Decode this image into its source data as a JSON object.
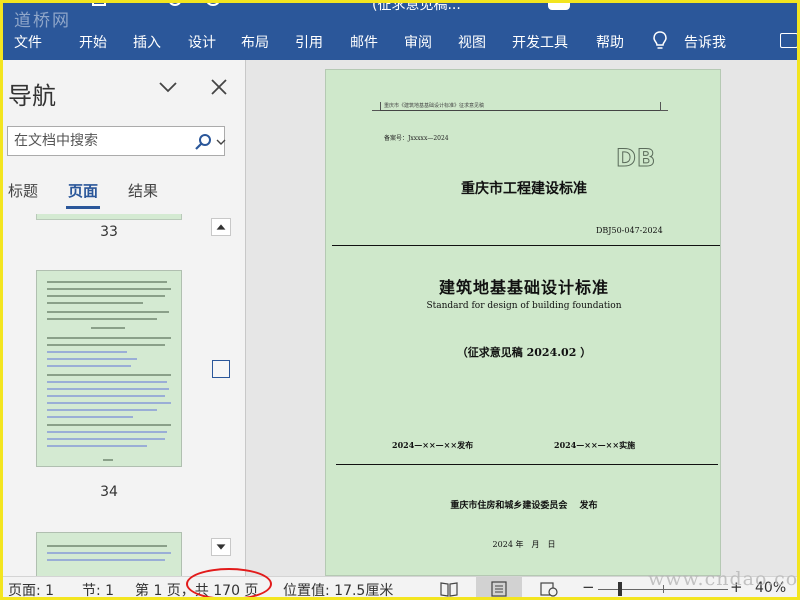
{
  "watermark_top": "道桥网",
  "watermark_bottom": "www.cndao.com",
  "window": {
    "title": "(征求意见稿..."
  },
  "ribbon": {
    "tabs": [
      "文件",
      "开始",
      "插入",
      "设计",
      "布局",
      "引用",
      "邮件",
      "审阅",
      "视图",
      "开发工具",
      "帮助"
    ],
    "tell_me": "告诉我",
    "accent_color": "#2b579a"
  },
  "nav": {
    "title": "导航",
    "search_placeholder": "在文档中搜索",
    "tabs": [
      "标题",
      "页面",
      "结果"
    ],
    "active_tab": "页面",
    "page_labels": [
      "33",
      "34"
    ]
  },
  "document": {
    "page_color": "#cfe8cb",
    "header_small": "重庆市《建筑地基基础设计标准》征求意见稿",
    "record_no": "备案号：Jxxxxx—2024",
    "logo": "DB",
    "standard_title": "重庆市工程建设标准",
    "standard_no": "DBJ50-047-2024",
    "main_title": "建筑地基基础设计标准",
    "english_title": "Standard for design of building foundation",
    "draft_label": "（征求意见稿 2024.02 ）",
    "publish_date": "2024—××—××发布",
    "effective_date": "2024—××—××实施",
    "publisher": "重庆市住房和城乡建设委员会　 发布",
    "pub_date": "2024 年　月　日"
  },
  "status": {
    "page": "页面: 1",
    "section": "节: 1",
    "page_of": "第 1 页，共 170 页",
    "position": "位置值: 17.5厘米",
    "zoom": "40%",
    "zoom_percent": 40,
    "highlight_color": "#e21b1b"
  }
}
